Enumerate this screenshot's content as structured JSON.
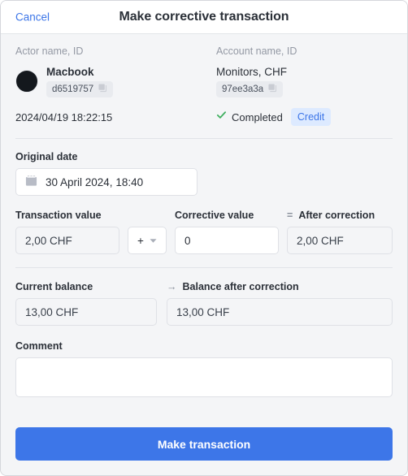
{
  "titlebar": {
    "cancel_label": "Cancel",
    "title": "Make corrective transaction"
  },
  "meta": {
    "actor": {
      "label": "Actor name, ID",
      "name": "Macbook",
      "id": "d6519757",
      "copy_icon": "copy-icon",
      "avatar_icon": "avatar"
    },
    "account": {
      "label": "Account name, ID",
      "name": "Monitors, CHF",
      "id": "97ee3a3a",
      "copy_icon": "copy-icon"
    },
    "timestamp": "2024/04/19 18:22:15",
    "status": {
      "icon": "check-icon",
      "text": "Completed",
      "badge": "Credit"
    }
  },
  "original_date": {
    "label": "Original date",
    "icon": "calendar-icon",
    "value": "30 April 2024, 18:40"
  },
  "values": {
    "transaction": {
      "label": "Transaction value",
      "value": "2,00 CHF"
    },
    "operator": {
      "selected": "+",
      "chevron_icon": "chevron-down-icon"
    },
    "corrective": {
      "label": "Corrective value",
      "value": "0",
      "placeholder": "0"
    },
    "after": {
      "symbol": "=",
      "label": "After correction",
      "value": "2,00 CHF"
    }
  },
  "balances": {
    "current": {
      "label": "Current balance",
      "value": "13,00 CHF"
    },
    "after": {
      "symbol": "→",
      "label": "Balance after correction",
      "value": "13,00 CHF"
    }
  },
  "comment": {
    "label": "Comment",
    "value": "",
    "placeholder": ""
  },
  "submit": {
    "label": "Make transaction"
  },
  "colors": {
    "accent": "#3d76e8",
    "success": "#3faf5f",
    "badge_bg": "#ddeaff",
    "page_bg": "#f4f5f7",
    "border": "#dfe1e6"
  }
}
